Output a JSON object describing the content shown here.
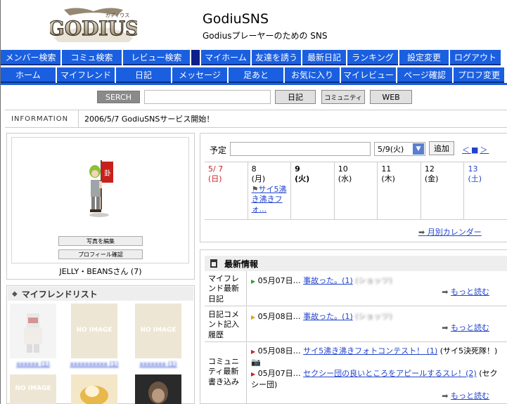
{
  "header": {
    "logo_text": "GODIUS",
    "logo_kana": "ガディウス",
    "site_title": "GodiuSNS",
    "site_subtitle": "Godiusプレーヤーのための SNS"
  },
  "nav_top": [
    "メンバー検索",
    "コミュ検索",
    "レビュー検索",
    "マイホーム",
    "友達を誘う",
    "最新日記",
    "ランキング",
    "設定変更",
    "ログアウト"
  ],
  "nav_bottom": [
    "ホーム",
    "マイフレンド",
    "日記",
    "メッセージ",
    "足あと",
    "お気に入り",
    "マイレビュー",
    "ページ確認",
    "プロフ変更"
  ],
  "search": {
    "label": "SERCH",
    "buttons": [
      "日記",
      "コミュニティ",
      "WEB"
    ]
  },
  "information": {
    "label": "INFORMATION",
    "text": "2006/5/7 GodiuSNSサービス開始！"
  },
  "profile": {
    "edit_photo": "写真を編集",
    "confirm_profile": "プロフィール確認",
    "name": "JELLY・BEANSさん (7)"
  },
  "friends": {
    "title": "マイフレンドリスト",
    "no_image": "NO IMAGE",
    "names": [
      "xxxxxx (1)",
      "xxxxxxxxxx (1)",
      "xxxxxxx (1)"
    ]
  },
  "calendar": {
    "label": "予定",
    "select_value": "5/9(火)",
    "add_button": "追加",
    "nav": "＜■＞",
    "days": [
      {
        "date": "5/ 7",
        "dow": "(日)",
        "color": "#cc2222",
        "bold": false
      },
      {
        "date": "8",
        "dow": "(月)",
        "color": "#000000",
        "bold": false,
        "event": "サイ5沸き沸きフォ..."
      },
      {
        "date": "9",
        "dow": "(火)",
        "color": "#000000",
        "bold": true
      },
      {
        "date": "10",
        "dow": "(水)",
        "color": "#000000",
        "bold": false
      },
      {
        "date": "11",
        "dow": "(木)",
        "color": "#000000",
        "bold": false
      },
      {
        "date": "12",
        "dow": "(金)",
        "color": "#000000",
        "bold": false
      },
      {
        "date": "13",
        "dow": "(土)",
        "color": "#2244cc",
        "bold": false
      }
    ],
    "monthly_link": "月別カレンダー"
  },
  "news": {
    "title": "最新情報",
    "rows": [
      {
        "category": "マイフレンド最新日記",
        "items": [
          {
            "date": "05月07日…",
            "link": "事故った。(1)",
            "extra": "(ショッツ)"
          }
        ],
        "more": "もっと読む"
      },
      {
        "category": "日記コメント記入履歴",
        "items": [
          {
            "date": "05月08日…",
            "link": "事故った。(1)",
            "extra": "(ショッツ)"
          }
        ],
        "more": "もっと読む"
      },
      {
        "category": "コミュニティ最新書き込み",
        "items": [
          {
            "date": "05月08日…",
            "link": "サイ5沸き沸きフォトコンテスト！ (1)",
            "extra": "(サイ5決死隊！)"
          },
          {
            "date": "05月07日…",
            "link": "セクシー団の良いところをアピールするスレ！(2)",
            "extra": "(セクシー団)"
          }
        ],
        "more": "もっと読む"
      }
    ]
  },
  "colors": {
    "nav_blue": "#1a5fe0",
    "nav_dark": "#0c1f8a",
    "link": "#2244cc"
  }
}
